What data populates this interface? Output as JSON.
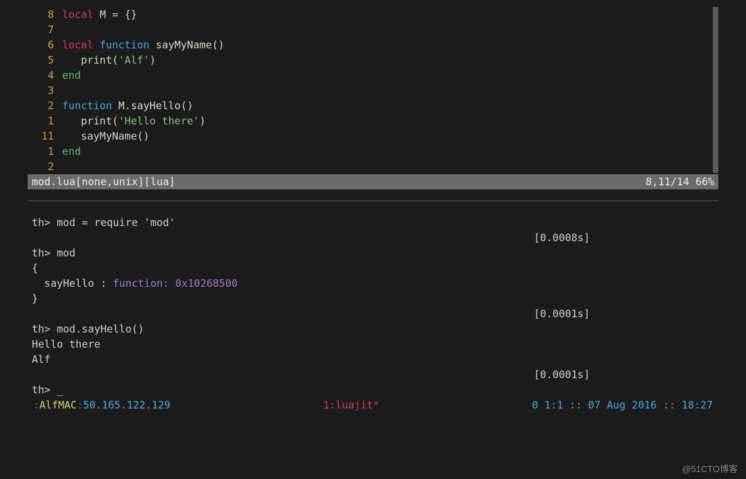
{
  "editor": {
    "lines": [
      {
        "n": "8",
        "current": false,
        "tokens": [
          {
            "t": "local ",
            "c": "kw-local"
          },
          {
            "t": "M ",
            "c": "ident"
          },
          {
            "t": "= ",
            "c": "op"
          },
          {
            "t": "{}",
            "c": "plain"
          }
        ]
      },
      {
        "n": "7",
        "current": false,
        "tokens": []
      },
      {
        "n": "6",
        "current": false,
        "tokens": [
          {
            "t": "local ",
            "c": "kw-local"
          },
          {
            "t": "function ",
            "c": "kw-function"
          },
          {
            "t": "sayMyName",
            "c": "fn-name"
          },
          {
            "t": "()",
            "c": "paren"
          }
        ]
      },
      {
        "n": "5",
        "current": false,
        "tokens": [
          {
            "t": "   ",
            "c": "plain"
          },
          {
            "t": "print",
            "c": "fn-name"
          },
          {
            "t": "(",
            "c": "paren"
          },
          {
            "t": "'Alf'",
            "c": "str"
          },
          {
            "t": ")",
            "c": "paren"
          }
        ]
      },
      {
        "n": "4",
        "current": false,
        "tokens": [
          {
            "t": "end",
            "c": "kw-end"
          }
        ]
      },
      {
        "n": "3",
        "current": false,
        "tokens": []
      },
      {
        "n": "2",
        "current": false,
        "tokens": [
          {
            "t": "function ",
            "c": "kw-function"
          },
          {
            "t": "M",
            "c": "ident"
          },
          {
            "t": ".",
            "c": "dot"
          },
          {
            "t": "sayHello",
            "c": "fn-name"
          },
          {
            "t": "()",
            "c": "paren"
          }
        ]
      },
      {
        "n": "1",
        "current": false,
        "tokens": [
          {
            "t": "   ",
            "c": "plain"
          },
          {
            "t": "print",
            "c": "fn-name"
          },
          {
            "t": "(",
            "c": "paren"
          },
          {
            "t": "'Hello there'",
            "c": "str"
          },
          {
            "t": ")",
            "c": "paren"
          }
        ]
      },
      {
        "n": "11",
        "current": true,
        "tokens": [
          {
            "t": "   ",
            "c": "plain"
          },
          {
            "t": "sayMyName",
            "c": "fn-name"
          },
          {
            "t": "()",
            "c": "paren"
          }
        ]
      },
      {
        "n": "1",
        "current": false,
        "tokens": [
          {
            "t": "end",
            "c": "kw-end"
          }
        ]
      },
      {
        "n": "2",
        "current": false,
        "tokens": []
      }
    ]
  },
  "status": {
    "left": "mod.lua[none,unix][lua]",
    "right": "8,11/14 66%"
  },
  "terminal": {
    "lines": [
      {
        "type": "cmd",
        "prompt": "th> ",
        "text": "mod = require 'mod'"
      },
      {
        "type": "time",
        "text": "[0.0008s]"
      },
      {
        "type": "cmd",
        "prompt": "th> ",
        "text": "mod"
      },
      {
        "type": "out",
        "text": "{"
      },
      {
        "type": "func",
        "key": "  sayHello : ",
        "val": "function: 0x10268500"
      },
      {
        "type": "out",
        "text": "}"
      },
      {
        "type": "time",
        "text": "[0.0001s]"
      },
      {
        "type": "cmd",
        "prompt": "th> ",
        "text": "mod.sayHello()"
      },
      {
        "type": "out",
        "text": "Hello there"
      },
      {
        "type": "out",
        "text": "Alf"
      },
      {
        "type": "time",
        "text": "[0.0001s]"
      },
      {
        "type": "cmd",
        "prompt": "th> ",
        "text": "_"
      }
    ]
  },
  "tmux": {
    "left_prefix": ": ",
    "host": "AlfMAC",
    "mid_sep": " : ",
    "ip": "50.165.122.129",
    "center": "1:luajit*",
    "right": "0 1:1 :: 07 Aug 2016 :: 18:27"
  },
  "watermark": "@51CTO博客"
}
